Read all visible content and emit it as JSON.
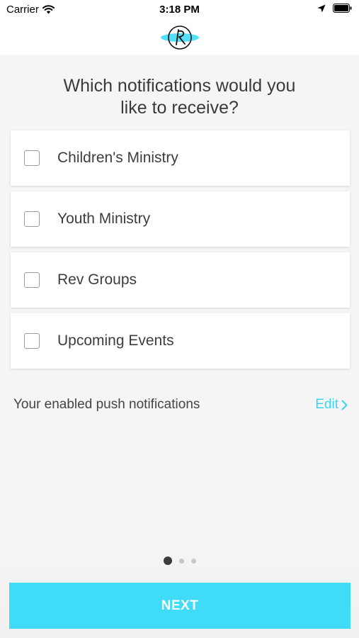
{
  "status_bar": {
    "carrier": "Carrier",
    "time": "3:18 PM",
    "icons": [
      "wifi-icon",
      "location-arrow-icon",
      "battery-icon"
    ]
  },
  "header": {
    "logo": "rev-logo-icon",
    "accent_color": "#40dcf7"
  },
  "question": {
    "line1": "Which notifications would you",
    "line2": "like to receive?"
  },
  "options": [
    {
      "label": "Children's Ministry",
      "checked": false
    },
    {
      "label": "Youth Ministry",
      "checked": false
    },
    {
      "label": "Rev Groups",
      "checked": false
    },
    {
      "label": "Upcoming Events",
      "checked": false
    }
  ],
  "push": {
    "label": "Your enabled push notifications",
    "edit_label": "Edit",
    "edit_color": "#3ad4f0"
  },
  "pagination": {
    "current": 1,
    "total": 3
  },
  "next_button": {
    "label": "NEXT",
    "color": "#40dcf7"
  }
}
